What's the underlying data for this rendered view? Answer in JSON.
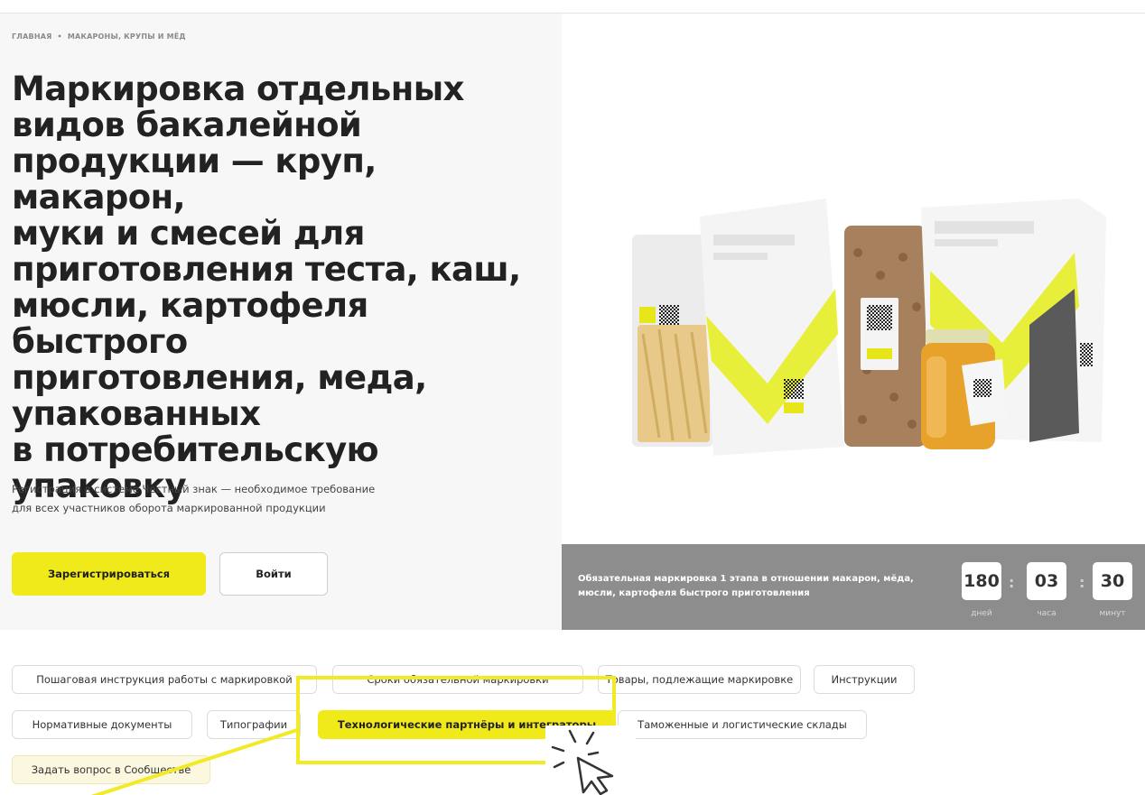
{
  "breadcrumb": {
    "home": "ГЛАВНАЯ",
    "separator": "•",
    "current": "МАКАРОНЫ, КРУПЫ И МЁД"
  },
  "hero": {
    "title": "Маркировка отдельных\nвидов бакалейной\nпродукции — круп, макарон,\nмуки и смесей для\nприготовления теста, каш,\nмюсли, картофеля быстрого\nприготовления, меда,\nупакованных\nв потребительскую\nупаковку",
    "subtitle": "Регистрация в системе Честный знак — необходимое требование\nдля всех участников оборота маркированной продукции",
    "register_label": "Зарегистрироваться",
    "login_label": "Войти"
  },
  "countdown": {
    "text": "Обязательная маркировка 1 этапа в отношении макарон, мёда,\nмюсли, картофеля быстрого приготовления",
    "days": "180",
    "hours": "03",
    "minutes": "30",
    "days_label": "дней",
    "hours_label": "часа",
    "minutes_label": "минут",
    "colon": ":"
  },
  "tags": [
    {
      "label": "Пошаговая инструкция работы с маркировкой"
    },
    {
      "label": "Сроки обязательной маркировки"
    },
    {
      "label": "Товары, подлежащие маркировке"
    },
    {
      "label": "Инструкции"
    },
    {
      "label": "Нормативные документы"
    },
    {
      "label": "Типографии"
    },
    {
      "label": "Технологические партнёры и интеграторы",
      "active": true
    },
    {
      "label": "Таможенные и логистические склады"
    },
    {
      "label": "Задать вопрос в Сообществе"
    }
  ],
  "colors": {
    "accent": "#f0ea1a",
    "countdown_bg": "#8d8d8d",
    "hero_bg": "#f7f7f7"
  },
  "icons": {
    "cursor": "pointer-cursor-icon",
    "click_burst": "click-burst-icon",
    "qr": "qr-code-icon",
    "brand_mark": "checkmark-logo-icon"
  }
}
